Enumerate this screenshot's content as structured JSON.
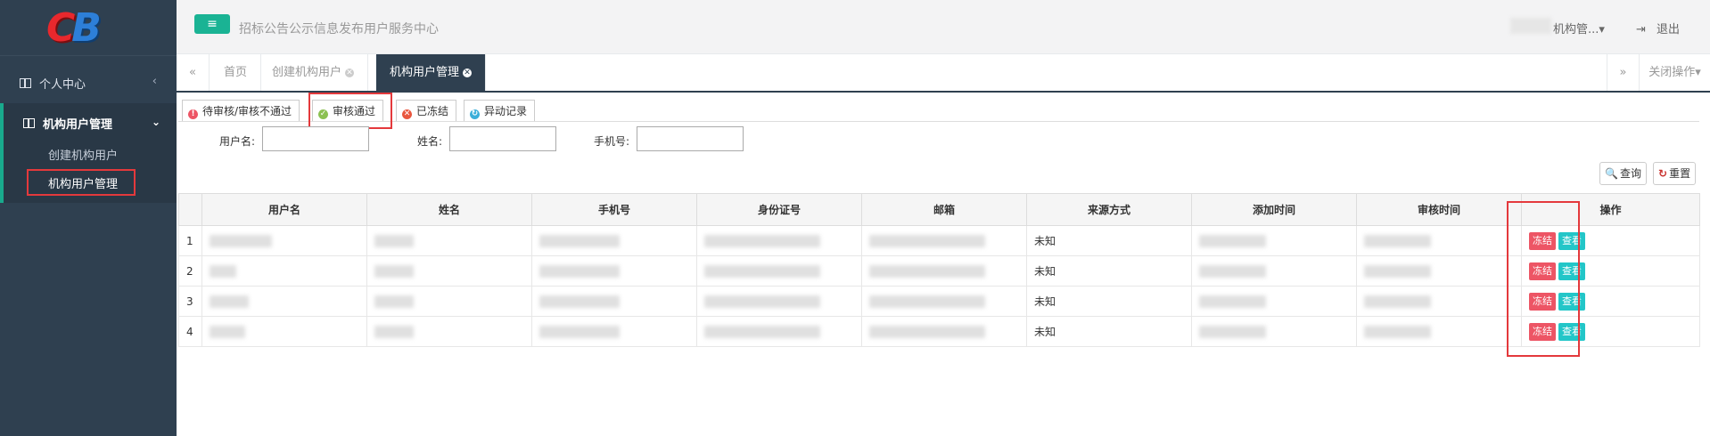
{
  "app": {
    "logo": {
      "left": "C",
      "right": "B"
    },
    "title": "招标公告公示信息发布用户服务中心"
  },
  "header": {
    "user_label": "机构管...",
    "user_caret": "▾",
    "logout_label": "退出",
    "logout_icon": "sign-out-icon",
    "menu_icon": "≡"
  },
  "sidebar": {
    "personal": {
      "label": "个人中心",
      "arrow": "‹"
    },
    "group": {
      "label": "机构用户管理",
      "arrow": "⌄"
    },
    "items": [
      {
        "label": "创建机构用户"
      },
      {
        "label": "机构用户管理"
      }
    ]
  },
  "tabs": {
    "prev": "«",
    "next": "»",
    "close_ops": "关闭操作▾",
    "items": [
      {
        "label": "首页",
        "closable": false
      },
      {
        "label": "创建机构用户",
        "closable": true
      },
      {
        "label": "机构用户管理",
        "closable": true,
        "active": true
      }
    ]
  },
  "status_tabs": [
    {
      "label": "待审核/审核不通过",
      "icon": "!",
      "color": "#ed5565"
    },
    {
      "label": "审核通过",
      "icon": "✓",
      "color": "#8cc152",
      "active": true
    },
    {
      "label": "已冻结",
      "icon": "✕",
      "color": "#e9573f"
    },
    {
      "label": "异动记录",
      "icon": "↻",
      "color": "#3bafda"
    }
  ],
  "filters": {
    "username": {
      "label": "用户名:",
      "value": ""
    },
    "name": {
      "label": "姓名:",
      "value": ""
    },
    "phone": {
      "label": "手机号:",
      "value": ""
    }
  },
  "buttons": {
    "query": {
      "label": "查询",
      "icon": "🔍"
    },
    "reset": {
      "label": "重置",
      "icon": "↻"
    }
  },
  "table": {
    "columns": [
      "",
      "用户名",
      "姓名",
      "手机号",
      "身份证号",
      "邮箱",
      "来源方式",
      "添加时间",
      "审核时间",
      "操作"
    ],
    "rows": [
      {
        "num": "1",
        "source": "未知"
      },
      {
        "num": "2",
        "source": "未知"
      },
      {
        "num": "3",
        "source": "未知"
      },
      {
        "num": "4",
        "source": "未知"
      }
    ],
    "actions": {
      "freeze": "冻结",
      "view": "查看"
    }
  }
}
